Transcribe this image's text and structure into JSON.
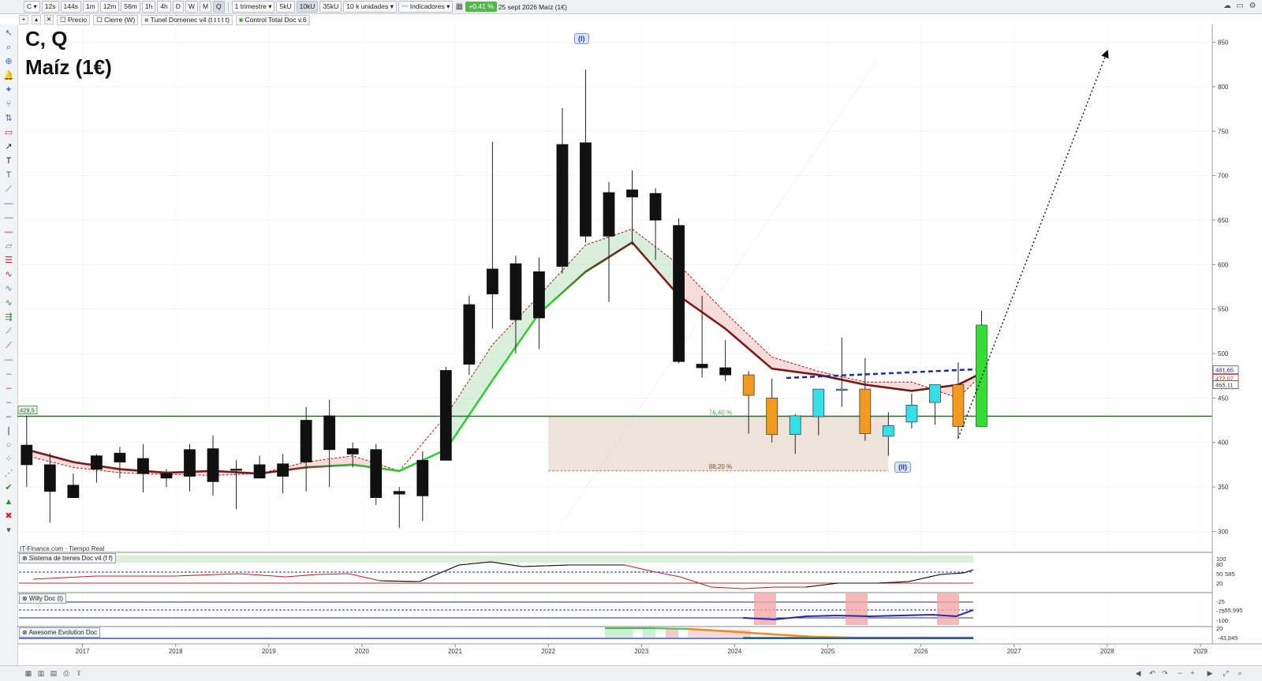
{
  "toolbar": {
    "symbol": "C",
    "intervals": [
      "12s",
      "144s",
      "1m",
      "12m",
      "56m",
      "1h",
      "4h",
      "D",
      "W",
      "M",
      "Q"
    ],
    "period": "1 trimestre",
    "units": [
      "5kU",
      "10kU",
      "35kU"
    ],
    "quantity": "10 k unidades",
    "indicators": "Indicadores",
    "change": "+0.41 %",
    "date": "25 sept 2026",
    "instrument": "Maíz (1€)"
  },
  "legend": {
    "items": [
      "Precio",
      "Cierre (W)",
      "Tunel Domenec v4 (t t t t t)",
      "Control Total Doc v.6"
    ]
  },
  "chart": {
    "title_line1": "C, Q",
    "title_line2": "Maíz (1€)",
    "source": "IT-Finance.com - Tiempo Real",
    "wave_1": "(I)",
    "wave_2": "(II)",
    "fib_1": "76,40 %",
    "fib_2": "88,20 %",
    "level_left": "429,5",
    "price_ticks": [
      "850",
      "800",
      "750",
      "700",
      "650",
      "600",
      "550",
      "500",
      "450",
      "400",
      "350",
      "300"
    ],
    "year_ticks": [
      "2017",
      "2018",
      "2019",
      "2020",
      "2021",
      "2022",
      "2023",
      "2024",
      "2025",
      "2026",
      "2027",
      "2028",
      "2029"
    ],
    "right_labels": [
      {
        "text": "481,65",
        "color": "#1f2d9c"
      },
      {
        "text": "472,07",
        "color": "#b2171c"
      },
      {
        "text": "465,11",
        "color": "#333333"
      }
    ]
  },
  "chart_data": {
    "type": "candlestick",
    "ylim": [
      280,
      870
    ],
    "x_range": [
      2016.3,
      2029
    ],
    "horizontal_level": 429.5,
    "candles": [
      {
        "x": 2016.4,
        "o": 397,
        "h": 430,
        "l": 350,
        "c": 375
      },
      {
        "x": 2016.65,
        "o": 375,
        "h": 388,
        "l": 310,
        "c": 345
      },
      {
        "x": 2016.9,
        "o": 352,
        "h": 365,
        "l": 340,
        "c": 338
      },
      {
        "x": 2017.15,
        "o": 370,
        "h": 387,
        "l": 355,
        "c": 385
      },
      {
        "x": 2017.4,
        "o": 388,
        "h": 395,
        "l": 360,
        "c": 378
      },
      {
        "x": 2017.65,
        "o": 382,
        "h": 398,
        "l": 344,
        "c": 365
      },
      {
        "x": 2017.9,
        "o": 365,
        "h": 370,
        "l": 350,
        "c": 360
      },
      {
        "x": 2018.15,
        "o": 392,
        "h": 398,
        "l": 345,
        "c": 362
      },
      {
        "x": 2018.4,
        "o": 393,
        "h": 408,
        "l": 340,
        "c": 356
      },
      {
        "x": 2018.65,
        "o": 370,
        "h": 380,
        "l": 325,
        "c": 370
      },
      {
        "x": 2018.9,
        "o": 375,
        "h": 385,
        "l": 362,
        "c": 360
      },
      {
        "x": 2019.15,
        "o": 376,
        "h": 387,
        "l": 343,
        "c": 362
      },
      {
        "x": 2019.4,
        "o": 425,
        "h": 440,
        "l": 345,
        "c": 378
      },
      {
        "x": 2019.65,
        "o": 430,
        "h": 448,
        "l": 350,
        "c": 392
      },
      {
        "x": 2019.9,
        "o": 393,
        "h": 400,
        "l": 372,
        "c": 387
      },
      {
        "x": 2020.15,
        "o": 392,
        "h": 398,
        "l": 330,
        "c": 338
      },
      {
        "x": 2020.4,
        "o": 345,
        "h": 350,
        "l": 304,
        "c": 342
      },
      {
        "x": 2020.65,
        "o": 380,
        "h": 390,
        "l": 312,
        "c": 340
      },
      {
        "x": 2020.9,
        "o": 481,
        "h": 485,
        "l": 380,
        "c": 380
      },
      {
        "x": 2021.15,
        "o": 555,
        "h": 565,
        "l": 476,
        "c": 488
      },
      {
        "x": 2021.4,
        "o": 595,
        "h": 738,
        "l": 528,
        "c": 567
      },
      {
        "x": 2021.65,
        "o": 601,
        "h": 610,
        "l": 500,
        "c": 538
      },
      {
        "x": 2021.9,
        "o": 592,
        "h": 608,
        "l": 505,
        "c": 540
      },
      {
        "x": 2022.15,
        "o": 735,
        "h": 776,
        "l": 590,
        "c": 598
      },
      {
        "x": 2022.4,
        "o": 737,
        "h": 819,
        "l": 625,
        "c": 632
      },
      {
        "x": 2022.65,
        "o": 681,
        "h": 693,
        "l": 558,
        "c": 632
      },
      {
        "x": 2022.9,
        "o": 684,
        "h": 706,
        "l": 622,
        "c": 676
      },
      {
        "x": 2023.15,
        "o": 680,
        "h": 686,
        "l": 605,
        "c": 650
      },
      {
        "x": 2023.4,
        "o": 644,
        "h": 652,
        "l": 489,
        "c": 491
      },
      {
        "x": 2023.65,
        "o": 488,
        "h": 565,
        "l": 473,
        "c": 484
      },
      {
        "x": 2023.9,
        "o": 484,
        "h": 515,
        "l": 469,
        "c": 476
      },
      {
        "x": 2024.15,
        "o": 476,
        "h": 480,
        "l": 410,
        "c": 453
      },
      {
        "x": 2024.4,
        "o": 409,
        "h": 472,
        "l": 400,
        "c": 450
      },
      {
        "x": 2024.65,
        "o": 409,
        "h": 432,
        "l": 387,
        "c": 430
      },
      {
        "x": 2024.9,
        "o": 429,
        "h": 460,
        "l": 408,
        "c": 460
      },
      {
        "x": 2025.15,
        "o": 460,
        "h": 518,
        "l": 440,
        "c": 460
      },
      {
        "x": 2025.4,
        "o": 410,
        "h": 495,
        "l": 402,
        "c": 460
      },
      {
        "x": 2025.65,
        "o": 407,
        "h": 434,
        "l": 385,
        "c": 419
      },
      {
        "x": 2025.9,
        "o": 423,
        "h": 455,
        "l": 416,
        "c": 442
      },
      {
        "x": 2026.15,
        "o": 445,
        "h": 460,
        "l": 420,
        "c": 465
      },
      {
        "x": 2026.4,
        "o": 418,
        "h": 490,
        "l": 404,
        "c": 465
      },
      {
        "x": 2026.65,
        "o": 418,
        "h": 548,
        "l": 418,
        "c": 532
      }
    ],
    "series": [
      {
        "name": "Tunel Domenec v4 (t t t t t)",
        "x": [
          2016.4,
          2016.9,
          2017.4,
          2017.9,
          2018.4,
          2018.9,
          2019.4,
          2019.9,
          2020.4,
          2020.9,
          2021.4,
          2021.9,
          2022.4,
          2022.9,
          2023.4,
          2023.9,
          2024.4,
          2024.9,
          2025.4,
          2025.9,
          2026.4,
          2026.65
        ],
        "values": [
          392,
          378,
          370,
          366,
          368,
          365,
          372,
          375,
          368,
          392,
          470,
          545,
          592,
          625,
          565,
          528,
          483,
          476,
          465,
          458,
          465,
          478
        ]
      },
      {
        "name": "Control Total Doc v.6",
        "x": [
          2016.4,
          2016.9,
          2017.4,
          2017.9,
          2018.4,
          2018.9,
          2019.4,
          2019.9,
          2020.4,
          2020.9,
          2021.4,
          2021.9,
          2022.4,
          2022.9,
          2023.4,
          2023.9,
          2024.4,
          2024.9,
          2025.4,
          2025.9,
          2026.4,
          2026.65
        ],
        "values": [
          385,
          372,
          366,
          364,
          363,
          365,
          378,
          385,
          368,
          430,
          510,
          565,
          622,
          640,
          600,
          546,
          496,
          480,
          468,
          468,
          450,
          476
        ]
      }
    ],
    "fib_zone": {
      "x0": 2022.0,
      "x1": 2025.65,
      "y_top": 429.5,
      "y_bottom": 368
    },
    "projection": {
      "x": [
        2026.4,
        2028.0
      ],
      "y": [
        405,
        840
      ]
    }
  }
}
